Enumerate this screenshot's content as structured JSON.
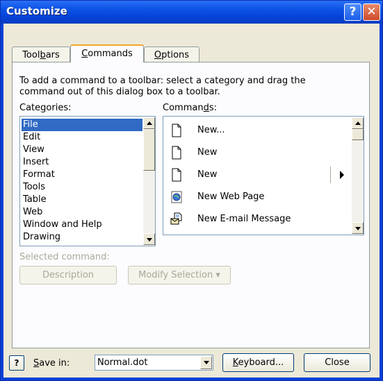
{
  "window": {
    "title": "Customize",
    "help_glyph": "?",
    "close_glyph": "✕"
  },
  "tabs": [
    {
      "label": "Toolbars",
      "mnemonic_pre": "Tool",
      "mnemonic": "b",
      "mnemonic_post": "ars"
    },
    {
      "label": "Commands",
      "mnemonic_pre": "",
      "mnemonic": "C",
      "mnemonic_post": "ommands",
      "active": true
    },
    {
      "label": "Options",
      "mnemonic_pre": "",
      "mnemonic": "O",
      "mnemonic_post": "ptions"
    }
  ],
  "instructions": {
    "line1": "To add a command to a toolbar: select a category and drag the",
    "line2": "command out of this dialog box to a toolbar."
  },
  "categories": {
    "label_pre": "Cate",
    "label_mnemonic": "g",
    "label_post": "ories:",
    "items": [
      "File",
      "Edit",
      "View",
      "Insert",
      "Format",
      "Tools",
      "Table",
      "Web",
      "Window and Help",
      "Drawing"
    ],
    "selected": "File"
  },
  "commands": {
    "label_pre": "Comman",
    "label_mnemonic": "d",
    "label_post": "s:",
    "items": [
      {
        "label": "New...",
        "icon": "blank-document-icon"
      },
      {
        "label": "New",
        "icon": "blank-document-icon"
      },
      {
        "label": "New",
        "icon": "blank-document-icon",
        "submenu": true
      },
      {
        "label": "New Web Page",
        "icon": "web-page-icon"
      },
      {
        "label": "New E-mail Message",
        "icon": "email-message-icon"
      }
    ]
  },
  "selected_command": {
    "label": "Selected command:",
    "description_button": "Description",
    "modify_button": "Modify Selection",
    "modify_arrow": "▾"
  },
  "footer": {
    "help_glyph": "?",
    "save_in_pre": "",
    "save_in_mnemonic": "S",
    "save_in_post": "ave in:",
    "save_in_value": "Normal.dot",
    "keyboard_pre": "",
    "keyboard_mnemonic": "K",
    "keyboard_post": "eyboard...",
    "close_label": "Close"
  },
  "colors": {
    "titlebar": "#0a55e5",
    "dialog_bg": "#ece9d8",
    "selection": "#316ac5",
    "disabled_text": "#aca899"
  }
}
